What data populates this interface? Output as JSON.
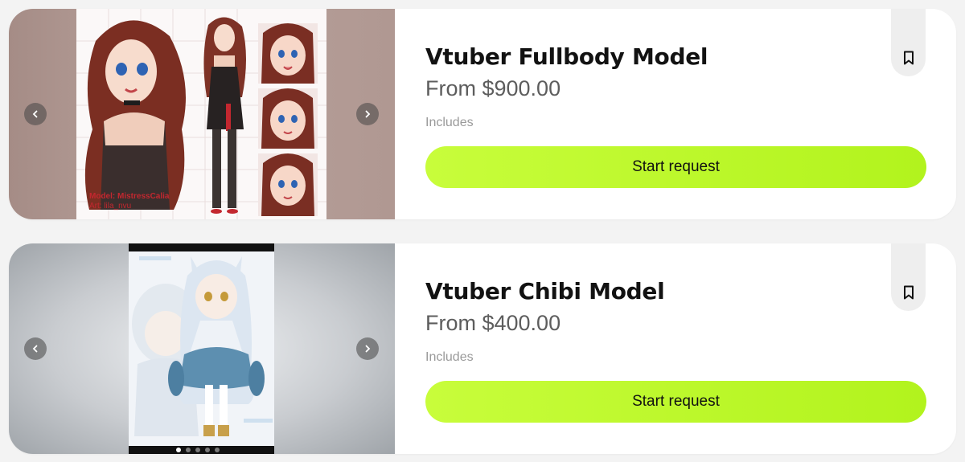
{
  "listings": [
    {
      "title": "Vtuber Fullbody Model",
      "price": "From $900.00",
      "includes_label": "Includes",
      "cta_label": "Start request",
      "art_caption_model": "Model: MistressCalia",
      "art_caption_art": "Art: lila_nvu"
    },
    {
      "title": "Vtuber Chibi Model",
      "price": "From $400.00",
      "includes_label": "Includes",
      "cta_label": "Start request",
      "carousel_pages": 5,
      "carousel_current": 1
    }
  ],
  "icons": {
    "prev": "chevron-left-icon",
    "next": "chevron-right-icon",
    "bookmark": "bookmark-icon"
  },
  "colors": {
    "cta": "#c8fd3b",
    "title": "#121212",
    "price": "#5d5d5d"
  }
}
